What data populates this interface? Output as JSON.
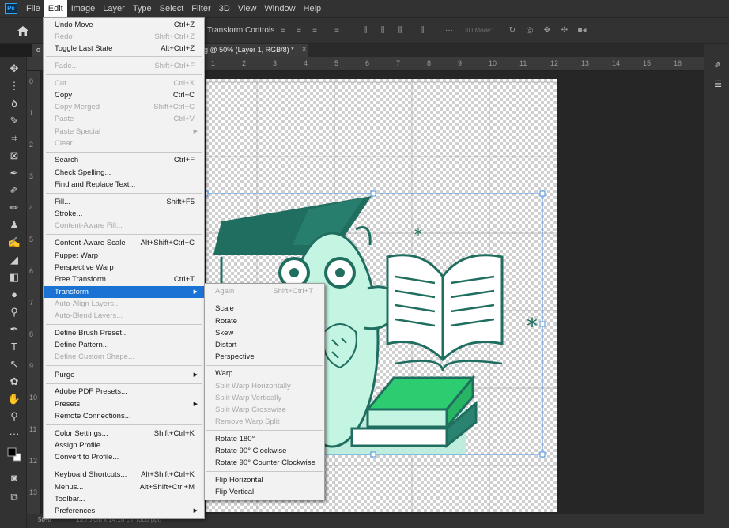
{
  "app": {
    "logo": "Ps"
  },
  "menubar": [
    "File",
    "Edit",
    "Image",
    "Layer",
    "Type",
    "Select",
    "Filter",
    "3D",
    "View",
    "Window",
    "Help"
  ],
  "options_bar": {
    "transform_controls_label": "Transform Controls",
    "mode_3d_label": "3D Mode:"
  },
  "tab": {
    "prefix": "o",
    "title": "g @ 50% (Layer 1, RGB/8) *",
    "close": "×"
  },
  "ruler": {
    "top": [
      "1",
      "2",
      "3",
      "4",
      "5",
      "6",
      "7",
      "8",
      "9",
      "10",
      "11",
      "12",
      "13",
      "14",
      "15",
      "16"
    ],
    "left": [
      "0",
      "1",
      "2",
      "3",
      "4",
      "5",
      "6",
      "7",
      "8",
      "9",
      "10",
      "11",
      "12",
      "13"
    ]
  },
  "status": {
    "zoom": "50%",
    "doc_size": "13.76 cm x 14.16 cm (300 ppi)"
  },
  "edit_menu": [
    {
      "label": "Undo Move",
      "shortcut": "Ctrl+Z"
    },
    {
      "label": "Redo",
      "shortcut": "Shift+Ctrl+Z",
      "disabled": true
    },
    {
      "label": "Toggle Last State",
      "shortcut": "Alt+Ctrl+Z"
    },
    {
      "label": "Fade...",
      "shortcut": "Shift+Ctrl+F",
      "disabled": true
    },
    {
      "label": "Cut",
      "shortcut": "Ctrl+X",
      "disabled": true
    },
    {
      "label": "Copy",
      "shortcut": "Ctrl+C"
    },
    {
      "label": "Copy Merged",
      "shortcut": "Shift+Ctrl+C",
      "disabled": true
    },
    {
      "label": "Paste",
      "shortcut": "Ctrl+V",
      "disabled": true
    },
    {
      "label": "Paste Special",
      "disabled": true
    },
    {
      "label": "Clear",
      "disabled": true
    },
    {
      "label": "Search",
      "shortcut": "Ctrl+F"
    },
    {
      "label": "Check Spelling..."
    },
    {
      "label": "Find and Replace Text..."
    },
    {
      "label": "Fill...",
      "shortcut": "Shift+F5"
    },
    {
      "label": "Stroke..."
    },
    {
      "label": "Content-Aware Fill...",
      "disabled": true
    },
    {
      "label": "Content-Aware Scale",
      "shortcut": "Alt+Shift+Ctrl+C"
    },
    {
      "label": "Puppet Warp"
    },
    {
      "label": "Perspective Warp"
    },
    {
      "label": "Free Transform",
      "shortcut": "Ctrl+T"
    },
    {
      "label": "Transform"
    },
    {
      "label": "Auto-Align Layers...",
      "disabled": true
    },
    {
      "label": "Auto-Blend Layers...",
      "disabled": true
    },
    {
      "label": "Define Brush Preset..."
    },
    {
      "label": "Define Pattern..."
    },
    {
      "label": "Define Custom Shape...",
      "disabled": true
    },
    {
      "label": "Purge"
    },
    {
      "label": "Adobe PDF Presets..."
    },
    {
      "label": "Presets"
    },
    {
      "label": "Remote Connections..."
    },
    {
      "label": "Color Settings...",
      "shortcut": "Shift+Ctrl+K"
    },
    {
      "label": "Assign Profile..."
    },
    {
      "label": "Convert to Profile..."
    },
    {
      "label": "Keyboard Shortcuts...",
      "shortcut": "Alt+Shift+Ctrl+K"
    },
    {
      "label": "Menus...",
      "shortcut": "Alt+Shift+Ctrl+M"
    },
    {
      "label": "Toolbar..."
    },
    {
      "label": "Preferences"
    }
  ],
  "transform_submenu": [
    {
      "label": "Again",
      "shortcut": "Shift+Ctrl+T",
      "disabled": true
    },
    {
      "label": "Scale"
    },
    {
      "label": "Rotate"
    },
    {
      "label": "Skew"
    },
    {
      "label": "Distort"
    },
    {
      "label": "Perspective"
    },
    {
      "label": "Warp"
    },
    {
      "label": "Split Warp Horizontally",
      "disabled": true
    },
    {
      "label": "Split Warp Vertically",
      "disabled": true
    },
    {
      "label": "Split Warp Crosswise",
      "disabled": true
    },
    {
      "label": "Remove Warp Split",
      "disabled": true
    },
    {
      "label": "Rotate 180°"
    },
    {
      "label": "Rotate 90° Clockwise"
    },
    {
      "label": "Rotate 90° Counter Clockwise"
    },
    {
      "label": "Flip Horizontal"
    },
    {
      "label": "Flip Vertical"
    }
  ],
  "colors": {
    "highlight": "#1a73d4",
    "dark_teal": "#1f6e60",
    "light_mint": "#b6f0d8",
    "green": "#2ecc71"
  }
}
